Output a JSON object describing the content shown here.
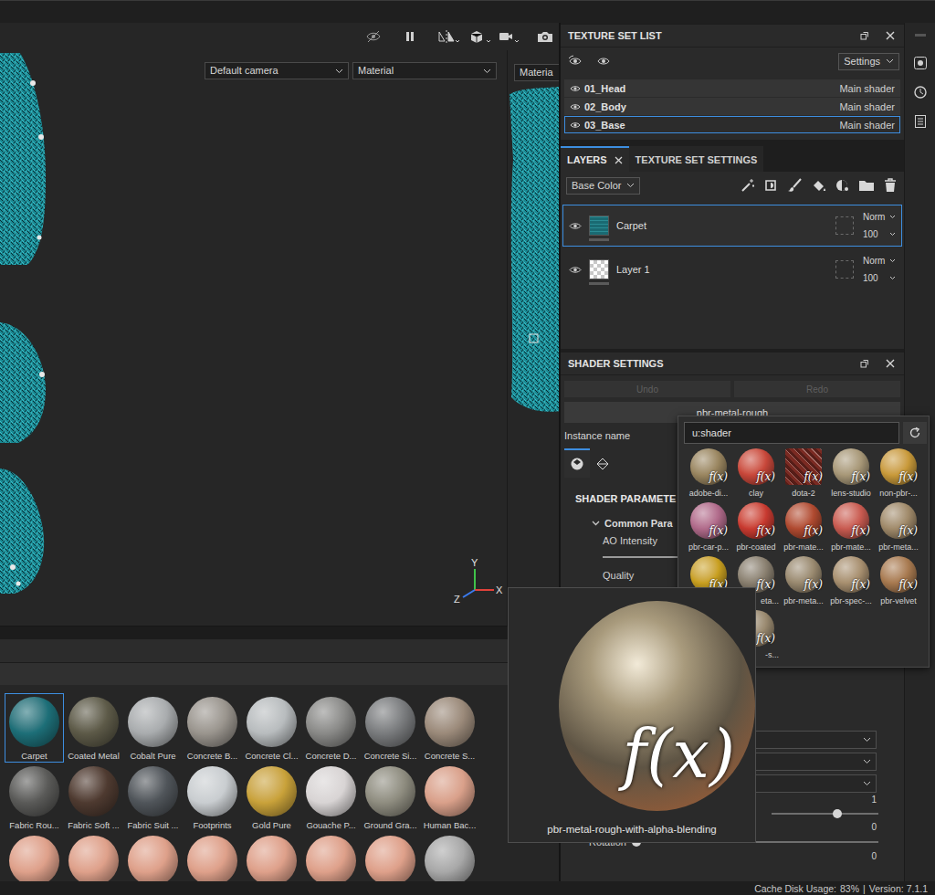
{
  "viewport": {
    "camera": "Default camera",
    "mode": "Material",
    "uv_mode": "Materia",
    "axes": [
      {
        "label": "Y",
        "color": "#3fc24a"
      },
      {
        "label": "X",
        "color": "#e0413a"
      },
      {
        "label": "Z",
        "color": "#3b7bef"
      }
    ]
  },
  "texture_set_list": {
    "title": "TEXTURE SET LIST",
    "settings": "Settings",
    "sets": [
      {
        "name": "01_Head",
        "shader": "Main shader",
        "selected": false
      },
      {
        "name": "02_Body",
        "shader": "Main shader",
        "selected": false
      },
      {
        "name": "03_Base",
        "shader": "Main shader",
        "selected": true
      }
    ]
  },
  "layers": {
    "tabs": [
      {
        "label": "LAYERS",
        "selected": true
      },
      {
        "label": "TEXTURE SET SETTINGS",
        "selected": false
      }
    ],
    "channel": "Base Color",
    "items": [
      {
        "name": "Carpet",
        "blend": "Norm",
        "opacity": "100",
        "selected": true,
        "kind": "fill"
      },
      {
        "name": "Layer 1",
        "blend": "Norm",
        "opacity": "100",
        "selected": false,
        "kind": "paint"
      }
    ]
  },
  "shader_settings": {
    "title": "SHADER SETTINGS",
    "undo": {
      "label": "Undo",
      "disabled": true
    },
    "redo": {
      "label": "Redo",
      "disabled": true
    },
    "shader": "pbr-metal-rough",
    "instance_label": "Instance name",
    "tabs": [
      {
        "selected": true
      },
      {
        "selected": false
      }
    ],
    "section": "SHADER PARAMETE",
    "group": "Common Para",
    "ao_label": "AO Intensity",
    "ao_level": 1,
    "quality_label": "Quality",
    "lower": [
      {
        "kind": "select"
      },
      {
        "kind": "select"
      },
      {
        "kind": "select"
      },
      {
        "kind": "value",
        "value": "1"
      },
      {
        "kind": "slider",
        "label": "",
        "level": 0.58
      },
      {
        "kind": "value",
        "value": "0"
      },
      {
        "kind": "slider",
        "label": "Rotation",
        "level": 0
      },
      {
        "kind": "value",
        "value": "0"
      }
    ]
  },
  "shader_picker": {
    "search": "u:shader",
    "badge": "f(x)",
    "items": [
      {
        "label": "adobe-di...",
        "color": "#9a8660",
        "kind": "ball",
        "cut": false
      },
      {
        "label": "clay",
        "color": "#c8473a",
        "kind": "ball",
        "cut": false
      },
      {
        "label": "dota-2",
        "color": "#7a2a22",
        "kind": "square",
        "cut": false
      },
      {
        "label": "lens-studio",
        "color": "#a89878",
        "kind": "ball",
        "cut": false
      },
      {
        "label": "non-pbr-...",
        "color": "#c99a3a",
        "kind": "ball",
        "cut": false
      },
      {
        "label": "pbr-car-p...",
        "color": "#b06a8a",
        "kind": "ball",
        "cut": false
      },
      {
        "label": "pbr-coated",
        "color": "#c83a30",
        "kind": "ball",
        "cut": false
      },
      {
        "label": "pbr-mate...",
        "color": "#b04a30",
        "kind": "ball",
        "cut": false
      },
      {
        "label": "pbr-mate...",
        "color": "#c85a50",
        "kind": "ball",
        "cut": false
      },
      {
        "label": "pbr-meta...",
        "color": "#a08a6a",
        "kind": "ball",
        "cut": false
      },
      {
        "label": "",
        "color": "#c9a020",
        "kind": "ball",
        "cut": false
      },
      {
        "label": "eta...",
        "color": "#8a8070",
        "kind": "ball",
        "cut": true
      },
      {
        "label": "pbr-meta...",
        "color": "#9a8a70",
        "kind": "ball",
        "cut": false
      },
      {
        "label": "pbr-spec-...",
        "color": "#a89070",
        "kind": "ball",
        "cut": false
      },
      {
        "label": "pbr-velvet",
        "color": "#a87a50",
        "kind": "ball",
        "cut": false
      },
      {
        "label": "",
        "color": "#8a7a60",
        "kind": "ball",
        "cut": false
      },
      {
        "label": "-s...",
        "color": "#9a8a70",
        "kind": "ball",
        "cut": true
      }
    ]
  },
  "tooltip": {
    "label": "pbr-metal-rough-with-alpha-blending"
  },
  "shelf": {
    "items": [
      {
        "label": "Carpet",
        "color": "#1d6f78",
        "selected": true
      },
      {
        "label": "Coated Metal",
        "color": "#5d5a48",
        "selected": false
      },
      {
        "label": "Cobalt Pure",
        "color": "#a9acae",
        "selected": false
      },
      {
        "label": "Concrete B...",
        "color": "#9a958e",
        "selected": false
      },
      {
        "label": "Concrete Cl...",
        "color": "#b8bcbe",
        "selected": false
      },
      {
        "label": "Concrete D...",
        "color": "#8a8a88",
        "selected": false
      },
      {
        "label": "Concrete Si...",
        "color": "#7a7c7e",
        "selected": false
      },
      {
        "label": "Concrete S...",
        "color": "#9b8a7a",
        "selected": false
      },
      {
        "label": "Fabric Rou...",
        "color": "#5a5a58",
        "selected": false
      },
      {
        "label": "Fabric Soft ...",
        "color": "#4e3a30",
        "selected": false
      },
      {
        "label": "Fabric Suit ...",
        "color": "#50555a",
        "selected": false
      },
      {
        "label": "Footprints",
        "color": "#c9cdd0",
        "selected": false
      },
      {
        "label": "Gold Pure",
        "color": "#c9a23a",
        "selected": false
      },
      {
        "label": "Gouache P...",
        "color": "#d8d4d4",
        "selected": false
      },
      {
        "label": "Ground Gra...",
        "color": "#8f8d80",
        "selected": false
      },
      {
        "label": "Human Bac...",
        "color": "#d9a08a",
        "selected": false
      },
      {
        "label": "",
        "color": "#dea08a",
        "selected": false
      },
      {
        "label": "",
        "color": "#dea08a",
        "selected": false
      },
      {
        "label": "",
        "color": "#dea08a",
        "selected": false
      },
      {
        "label": "",
        "color": "#dea08a",
        "selected": false
      },
      {
        "label": "",
        "color": "#dea08a",
        "selected": false
      },
      {
        "label": "",
        "color": "#dea08a",
        "selected": false
      },
      {
        "label": "",
        "color": "#dea08a",
        "selected": false
      },
      {
        "label": "",
        "color": "#a8a8a8",
        "selected": false
      }
    ]
  },
  "status_bar": {
    "cache_label": "Cache Disk Usage:",
    "cache_value": "83%",
    "separator": "|",
    "version": "Version: 7.1.1"
  }
}
